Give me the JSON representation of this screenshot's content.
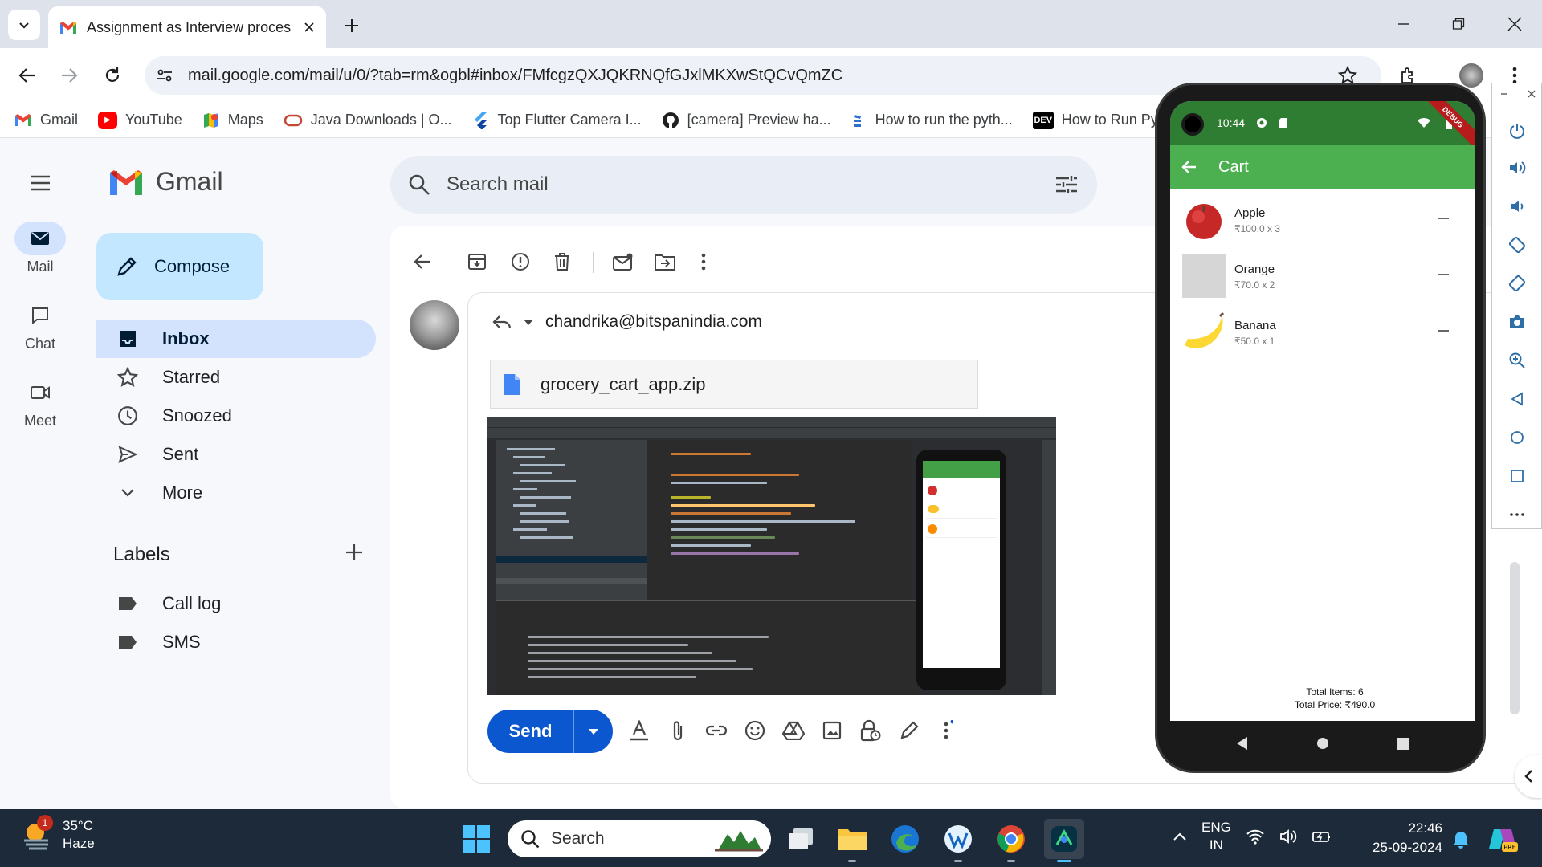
{
  "browser": {
    "tab_title": "Assignment as Interview proces",
    "url": "mail.google.com/mail/u/0/?tab=rm&ogbl#inbox/FMfcgzQXJQKRNQfGJxlMKXwStQCvQmZC",
    "bookmarks": [
      {
        "label": "Gmail",
        "icon": "gmail-icon"
      },
      {
        "label": "YouTube",
        "icon": "youtube-icon"
      },
      {
        "label": "Maps",
        "icon": "maps-icon"
      },
      {
        "label": "Java Downloads | O...",
        "icon": "oracle-icon"
      },
      {
        "label": "Top Flutter Camera I...",
        "icon": "flutter-icon"
      },
      {
        "label": "[camera] Preview ha...",
        "icon": "github-icon"
      },
      {
        "label": "How to run the pyth...",
        "icon": "stack-icon"
      },
      {
        "label": "How to Run Pyth",
        "icon": "dev-icon"
      }
    ]
  },
  "gmail": {
    "brand": "Gmail",
    "search_placeholder": "Search mail",
    "rail": [
      {
        "label": "Mail",
        "icon": "mail-icon"
      },
      {
        "label": "Chat",
        "icon": "chat-icon"
      },
      {
        "label": "Meet",
        "icon": "meet-icon"
      }
    ],
    "compose_label": "Compose",
    "nav": [
      {
        "label": "Inbox",
        "icon": "inbox-icon",
        "active": true
      },
      {
        "label": "Starred",
        "icon": "star-icon"
      },
      {
        "label": "Snoozed",
        "icon": "clock-icon"
      },
      {
        "label": "Sent",
        "icon": "send-icon"
      },
      {
        "label": "More",
        "icon": "chevron-down-icon"
      }
    ],
    "labels_heading": "Labels",
    "labels": [
      {
        "label": "Call log",
        "icon": "label-icon"
      },
      {
        "label": "SMS",
        "icon": "label-icon"
      }
    ],
    "reply_to": "chandrika@bitspanindia.com",
    "attachment_name": "grocery_cart_app.zip",
    "send_label": "Send"
  },
  "emulator": {
    "status_time": "10:44",
    "debug_label": "DEBUG",
    "app_title": "Cart",
    "items": [
      {
        "name": "Apple",
        "detail": "₹100.0 x 3"
      },
      {
        "name": "Orange",
        "detail": "₹70.0 x 2"
      },
      {
        "name": "Banana",
        "detail": "₹50.0 x 1"
      }
    ],
    "total_items": "Total Items: 6",
    "total_price": "Total Price: ₹490.0"
  },
  "taskbar": {
    "weather_badge": "1",
    "temperature": "35°C",
    "condition": "Haze",
    "search_placeholder": "Search",
    "lang_top": "ENG",
    "lang_bottom": "IN",
    "time": "22:46",
    "date": "25-09-2024"
  }
}
